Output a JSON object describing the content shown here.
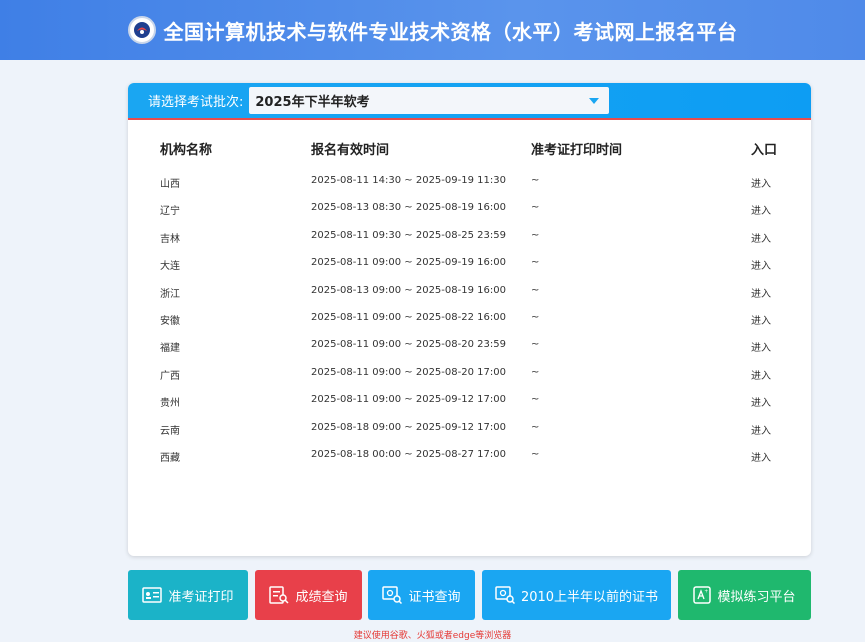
{
  "header": {
    "title": "全国计算机技术与软件专业技术资格（水平）考试网上报名平台"
  },
  "batch": {
    "label": "请选择考试批次:",
    "value": "2025年下半年软考"
  },
  "table": {
    "headers": [
      "机构名称",
      "报名有效时间",
      "准考证打印时间",
      "入口"
    ],
    "rows": [
      {
        "org": "山西",
        "reg": "2025-08-11 14:30 ~ 2025-09-19 11:30",
        "print": "~",
        "entry": "进入"
      },
      {
        "org": "辽宁",
        "reg": "2025-08-13 08:30 ~ 2025-08-19 16:00",
        "print": "~",
        "entry": "进入"
      },
      {
        "org": "吉林",
        "reg": "2025-08-11 09:30 ~ 2025-08-25 23:59",
        "print": "~",
        "entry": "进入"
      },
      {
        "org": "大连",
        "reg": "2025-08-11 09:00 ~ 2025-09-19 16:00",
        "print": "~",
        "entry": "进入"
      },
      {
        "org": "浙江",
        "reg": "2025-08-13 09:00 ~ 2025-08-19 16:00",
        "print": "~",
        "entry": "进入"
      },
      {
        "org": "安徽",
        "reg": "2025-08-11 09:00 ~ 2025-08-22 16:00",
        "print": "~",
        "entry": "进入"
      },
      {
        "org": "福建",
        "reg": "2025-08-11 09:00 ~ 2025-08-20 23:59",
        "print": "~",
        "entry": "进入"
      },
      {
        "org": "广西",
        "reg": "2025-08-11 09:00 ~ 2025-08-20 17:00",
        "print": "~",
        "entry": "进入"
      },
      {
        "org": "贵州",
        "reg": "2025-08-11 09:00 ~ 2025-09-12 17:00",
        "print": "~",
        "entry": "进入"
      },
      {
        "org": "云南",
        "reg": "2025-08-18 09:00 ~ 2025-09-12 17:00",
        "print": "~",
        "entry": "进入"
      },
      {
        "org": "西藏",
        "reg": "2025-08-18 00:00 ~ 2025-08-27 17:00",
        "print": "~",
        "entry": "进入"
      }
    ]
  },
  "buttons": [
    {
      "label": "准考证打印",
      "icon": "admission-card-icon",
      "color": "#1bb3c8"
    },
    {
      "label": "成绩查询",
      "icon": "score-search-icon",
      "color": "#e8404a"
    },
    {
      "label": "证书查询",
      "icon": "certificate-search-icon",
      "color": "#1aa6f2"
    },
    {
      "label": "2010上半年以前的证书",
      "icon": "old-certificate-icon",
      "color": "#1aa6f2"
    },
    {
      "label": "模拟练习平台",
      "icon": "practice-icon",
      "color": "#1fb86e"
    }
  ],
  "footer": {
    "note": "建议使用谷歌、火狐或者edge等浏览器"
  }
}
